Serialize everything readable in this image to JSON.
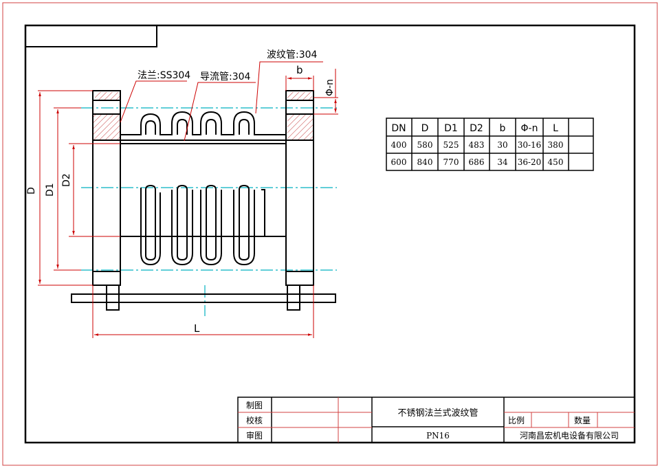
{
  "drawing": {
    "labels": {
      "flange": "法兰:SS304",
      "guide_tube": "导流管:304",
      "bellows": "波纹管:304",
      "b": "b",
      "phi_n": "Φ-n",
      "D": "D",
      "D1": "D1",
      "D2": "D2",
      "L": "L"
    }
  },
  "spec_table": {
    "headers": [
      "DN",
      "D",
      "D1",
      "D2",
      "b",
      "Φ-n",
      "L",
      ""
    ],
    "rows": [
      [
        "400",
        "580",
        "525",
        "483",
        "30",
        "30-16",
        "380",
        ""
      ],
      [
        "600",
        "840",
        "770",
        "686",
        "34",
        "36-20",
        "450",
        ""
      ]
    ]
  },
  "title_block": {
    "drawn_by": "制图",
    "checked_by": "校核",
    "approved_by": "审图",
    "part_name": "不锈钢法兰式波纹管",
    "pressure": "PN16",
    "scale": "比例",
    "quantity": "数量",
    "company": "河南昌宏机电设备有限公司"
  },
  "colors": {
    "outline": "#000000",
    "dimension": "#cc0000",
    "centerline": "#00b0c0",
    "border_red": "#d04040"
  }
}
